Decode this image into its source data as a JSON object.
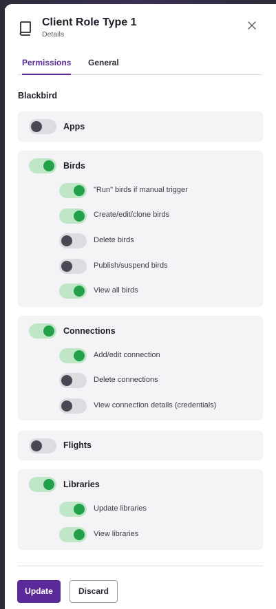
{
  "header": {
    "title": "Client Role Type 1",
    "subtitle": "Details",
    "icon": "book-icon",
    "close_icon": "close-icon"
  },
  "tabs": [
    {
      "label": "Permissions",
      "active": true
    },
    {
      "label": "General",
      "active": false
    }
  ],
  "section": {
    "title": "Blackbird"
  },
  "groups": [
    {
      "label": "Apps",
      "enabled": false,
      "items": []
    },
    {
      "label": "Birds",
      "enabled": true,
      "items": [
        {
          "label": "\"Run\" birds if manual trigger",
          "enabled": true
        },
        {
          "label": "Create/edit/clone birds",
          "enabled": true
        },
        {
          "label": "Delete birds",
          "enabled": false
        },
        {
          "label": "Publish/suspend birds",
          "enabled": false
        },
        {
          "label": "View all birds",
          "enabled": true
        }
      ]
    },
    {
      "label": "Connections",
      "enabled": true,
      "items": [
        {
          "label": "Add/edit connection",
          "enabled": true
        },
        {
          "label": "Delete connections",
          "enabled": false
        },
        {
          "label": "View connection details (credentials)",
          "enabled": false
        }
      ]
    },
    {
      "label": "Flights",
      "enabled": false,
      "items": []
    },
    {
      "label": "Libraries",
      "enabled": true,
      "items": [
        {
          "label": "Update libraries",
          "enabled": true
        },
        {
          "label": "View libraries",
          "enabled": true
        }
      ]
    }
  ],
  "footer": {
    "update_label": "Update",
    "discard_label": "Discard"
  },
  "colors": {
    "accent": "#5a2a9a",
    "toggle_on_track": "#bfe6c7",
    "toggle_on_knob": "#23a04a",
    "toggle_off_track": "#dcdce1",
    "toggle_off_knob": "#4a4752"
  }
}
